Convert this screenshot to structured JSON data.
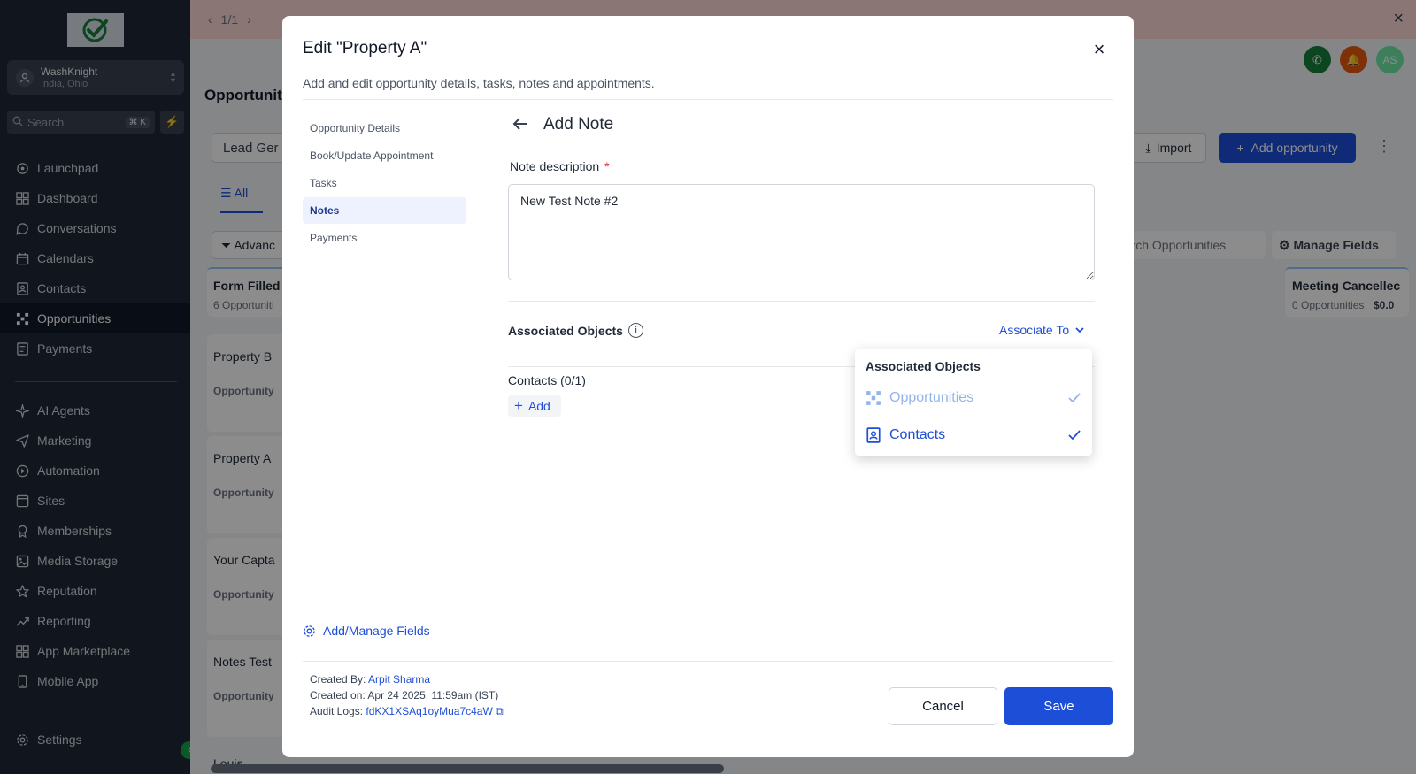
{
  "sidebar": {
    "account_name": "WashKnight",
    "account_location": "India, Ohio",
    "search_placeholder": "Search",
    "search_shortcut": "⌘ K",
    "items": [
      {
        "label": "Launchpad",
        "icon": "rocket-icon"
      },
      {
        "label": "Dashboard",
        "icon": "grid-icon"
      },
      {
        "label": "Conversations",
        "icon": "chat-icon"
      },
      {
        "label": "Calendars",
        "icon": "calendar-icon"
      },
      {
        "label": "Contacts",
        "icon": "contacts-icon"
      },
      {
        "label": "Opportunities",
        "icon": "opportunities-icon",
        "active": true
      },
      {
        "label": "Payments",
        "icon": "payments-icon"
      },
      {
        "label": "AI Agents",
        "icon": "sparkle-icon"
      },
      {
        "label": "Marketing",
        "icon": "send-icon"
      },
      {
        "label": "Automation",
        "icon": "automation-icon"
      },
      {
        "label": "Sites",
        "icon": "sites-icon"
      },
      {
        "label": "Memberships",
        "icon": "membership-icon"
      },
      {
        "label": "Media Storage",
        "icon": "image-icon"
      },
      {
        "label": "Reputation",
        "icon": "star-icon"
      },
      {
        "label": "Reporting",
        "icon": "trend-icon"
      },
      {
        "label": "App Marketplace",
        "icon": "apps-icon"
      },
      {
        "label": "Mobile App",
        "icon": "mobile-icon"
      }
    ],
    "settings_label": "Settings"
  },
  "background": {
    "pager": "1/1",
    "page_title": "Opportuniti",
    "pipeline_select": "Lead Ger",
    "tab_all": "All",
    "advanced": "Advanc",
    "import_label": "Import",
    "add_opportunity_label": "Add opportunity",
    "search_opportunities": "earch Opportunities",
    "manage_fields_label": "Manage Fields",
    "avatar_initials": "AS",
    "columns": [
      {
        "title": "Form Filled",
        "sub": "6 Opportuniti"
      },
      {
        "title": "Meeting Cancellec",
        "sub": "0 Opportunities",
        "amount": "$0.0"
      }
    ],
    "cards": [
      "Property B",
      "Property A",
      "Your Capta",
      "Notes Test",
      "Louis"
    ],
    "card_sub": "Opportunity"
  },
  "modal": {
    "title": "Edit \"Property A\"",
    "subtitle": "Add and edit opportunity details, tasks, notes and appointments.",
    "nav": [
      {
        "label": "Opportunity Details"
      },
      {
        "label": "Book/Update Appointment"
      },
      {
        "label": "Tasks"
      },
      {
        "label": "Notes",
        "active": true
      },
      {
        "label": "Payments"
      }
    ],
    "section_title": "Add Note",
    "note_label": "Note description",
    "required_mark": "*",
    "note_value": "New Test Note #2",
    "associated_label": "Associated Objects",
    "associate_to": "Associate To",
    "contacts_heading": "Contacts (0/1)",
    "add_label": "Add",
    "dropdown": {
      "heading": "Associated Objects",
      "options": [
        {
          "label": "Opportunities",
          "checked": true,
          "disabled": true,
          "icon": "opportunities-icon"
        },
        {
          "label": "Contacts",
          "checked": true,
          "disabled": false,
          "icon": "contact-card-icon"
        }
      ]
    },
    "manage_fields": "Add/Manage Fields",
    "created_by_label": "Created By:",
    "created_by": "Arpit Sharma",
    "created_on_label": "Created on:",
    "created_on": "Apr 24 2025, 11:59am (IST)",
    "audit_label": "Audit Logs:",
    "audit_id": "fdKX1XSAq1oyMua7c4aW",
    "cancel": "Cancel",
    "save": "Save"
  },
  "colors": {
    "primary": "#1d4ed8",
    "sidebar_bg": "#1f2937",
    "banner": "#fbd8d4"
  }
}
